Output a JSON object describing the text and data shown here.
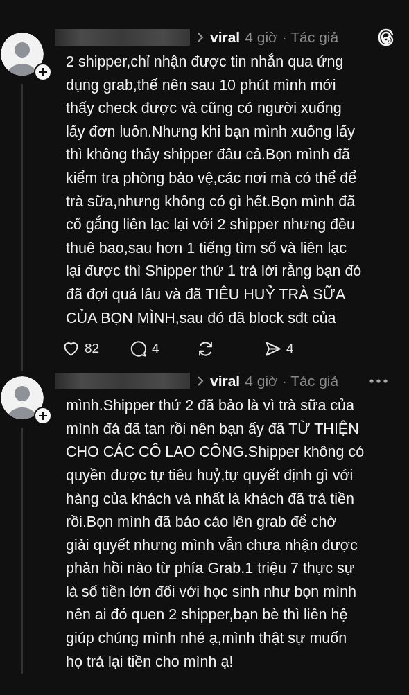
{
  "posts": [
    {
      "username": "viral",
      "time": "4 giờ",
      "role": "· Tác giả",
      "corner": {
        "kind": "logo"
      },
      "thread_line": true,
      "text": "2 shipper,chỉ nhận được tin nhắn qua ứng\ndụng grab,thế nên sau 10 phút mình mới\nthấy check được và cũng có người xuống\nlấy đơn luôn.Nhưng khi bạn mình xuống lấy\nthì không thấy shipper đâu cả.Bọn mình đã\nkiểm tra phòng bảo vệ,các nơi mà có thể để\ntrà sữa,nhưng không có gì hết.Bọn mình đã\ncố gắng liên lạc lại với 2 shipper nhưng đều\nthuê bao,sau hơn 1 tiếng tìm số và liên lạc\nlại được thì Shipper thứ 1 trả lời rằng bạn đó\nđã đợi quá lâu và đã TIÊU HUỶ TRÀ SỮA\nCỦA BỌN MÌNH,sau đó đã block sđt của",
      "actions": [
        {
          "kind": "like",
          "count": "82"
        },
        {
          "kind": "reply",
          "count": "4"
        },
        {
          "kind": "repost"
        },
        {
          "kind": "share",
          "count": "4"
        }
      ]
    },
    {
      "username": "viral",
      "time": "4 giờ",
      "role": "· Tác giả",
      "corner": {
        "kind": "more"
      },
      "thread_line": true,
      "text": "mình.Shipper thứ 2 đã bảo là vì trà sữa của\nmình đá đã tan rồi nên bạn ấy đã TỪ THIỆN\nCHO CÁC CÔ LAO CÔNG.Shipper không có\nquyền được tự tiêu huỷ,tự quyết định gì với\nhàng của khách và nhất là khách đã trả tiền\nrồi.Bọn mình đã báo cáo lên grab để chờ\ngiải quyết nhưng mình vẫn chưa nhận được\nphản hồi nào từ phía Grab.1 triệu 7 thực sự\nlà số tiền lớn đối với học sinh như bọn mình\nnên ai đó quen 2 shipper,bạn bè thì liên hệ\ngiúp chúng mình nhé ạ,mình thật sự muốn\nhọ trả lại tiền cho mình ạ!"
    }
  ]
}
